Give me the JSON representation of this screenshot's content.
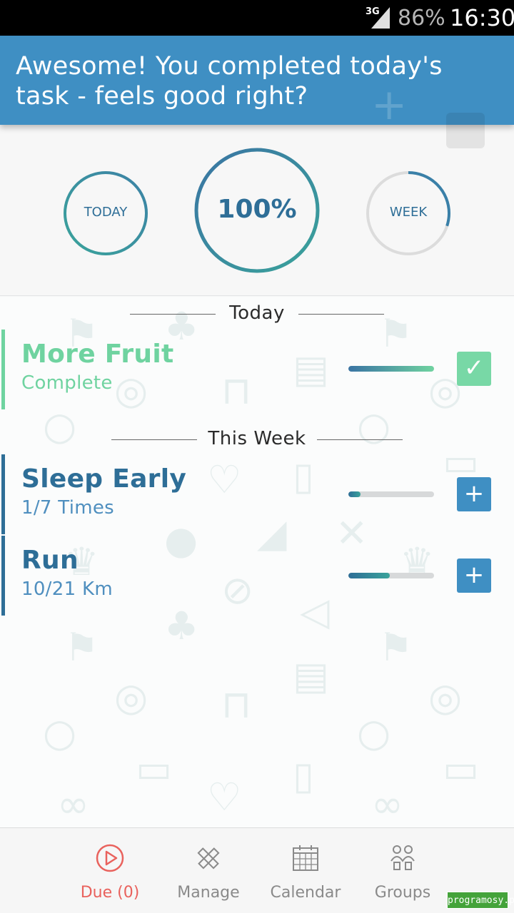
{
  "status_bar": {
    "network": "3G",
    "battery": "86%",
    "time": "16:30"
  },
  "toast": {
    "message": "Awesome! You completed today's task - feels good right?"
  },
  "progress": {
    "today": {
      "label": "TODAY",
      "fraction": 1.0
    },
    "overall": {
      "label": "100%",
      "fraction": 1.0
    },
    "week": {
      "label": "WEEK",
      "fraction": 0.3
    }
  },
  "sections": {
    "today": "Today",
    "week": "This Week"
  },
  "tasks_today": [
    {
      "name": "More Fruit",
      "status": "Complete",
      "progress": 1.0,
      "color": "#6fd3a0",
      "button_icon": "check-icon",
      "button_glyph": "✓"
    }
  ],
  "tasks_week": [
    {
      "name": "Sleep Early",
      "status": "1/7 Times",
      "progress": 0.14,
      "color": "#2e6e97",
      "button_icon": "plus-icon",
      "button_glyph": "+"
    },
    {
      "name": "Run",
      "status": "10/21 Km",
      "progress": 0.48,
      "color": "#2e6e97",
      "button_icon": "plus-icon",
      "button_glyph": "+"
    }
  ],
  "nav": [
    {
      "label": "Due (0)",
      "icon": "play-circle-icon",
      "active": true
    },
    {
      "label": "Manage",
      "icon": "pencil-ruler-icon",
      "active": false
    },
    {
      "label": "Calendar",
      "icon": "calendar-icon",
      "active": false
    },
    {
      "label": "Groups",
      "icon": "groups-icon",
      "active": false
    }
  ],
  "colors": {
    "accent_blue": "#3f8fc3",
    "teal": "#3aa39b",
    "green": "#6fd3a0",
    "nav_active": "#e9625d"
  },
  "watermark": "programosy.pl"
}
